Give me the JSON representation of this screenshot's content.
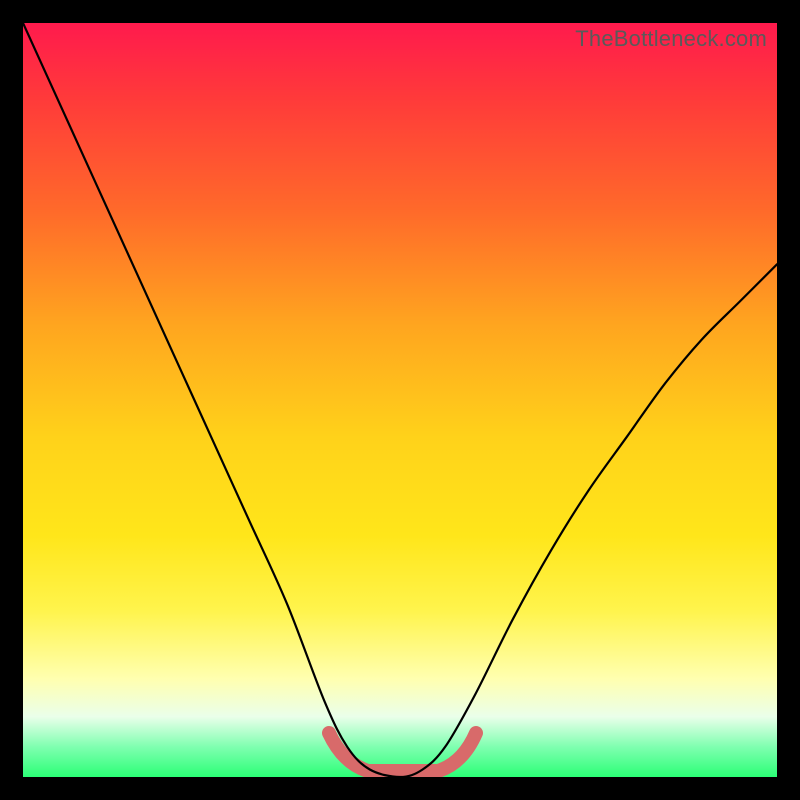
{
  "watermark": "TheBottleneck.com",
  "chart_data": {
    "type": "line",
    "title": "",
    "xlabel": "",
    "ylabel": "",
    "xlim": [
      0,
      100
    ],
    "ylim": [
      0,
      100
    ],
    "grid": false,
    "legend": false,
    "annotations": [],
    "series": [
      {
        "name": "bottleneck-curve",
        "color": "#000000",
        "x": [
          0,
          5,
          10,
          15,
          20,
          25,
          30,
          35,
          40,
          43,
          46,
          50,
          53,
          56,
          60,
          65,
          70,
          75,
          80,
          85,
          90,
          95,
          100
        ],
        "y": [
          100,
          89,
          78,
          67,
          56,
          45,
          34,
          23,
          10,
          4,
          1,
          0,
          1,
          4,
          11,
          21,
          30,
          38,
          45,
          52,
          58,
          63,
          68
        ]
      }
    ],
    "highlight_range": {
      "x": [
        40.5,
        55.5
      ],
      "y_at_x": [
        6,
        1,
        0,
        1,
        6
      ],
      "color": "#d86a6a",
      "note": "emphasized trough of curve"
    },
    "background_gradient": {
      "direction": "top-to-bottom",
      "stops": [
        {
          "pos": 0.0,
          "color": "#ff1a4d"
        },
        {
          "pos": 0.55,
          "color": "#ffd21a"
        },
        {
          "pos": 0.88,
          "color": "#ffffb0"
        },
        {
          "pos": 1.0,
          "color": "#2bff76"
        }
      ]
    }
  }
}
